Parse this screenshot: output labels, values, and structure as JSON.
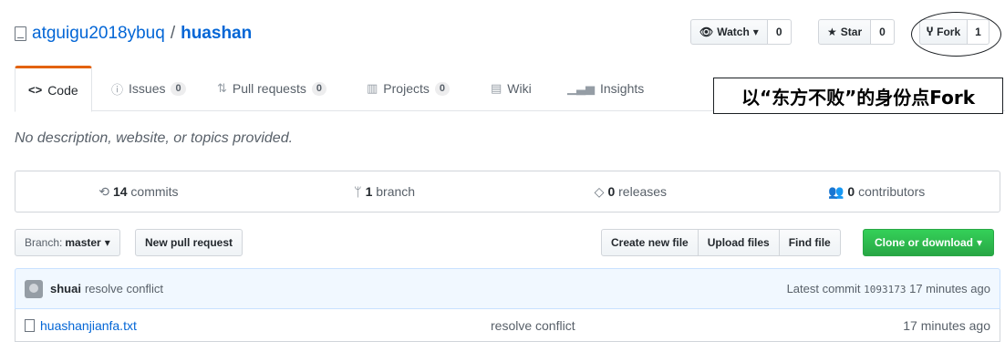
{
  "repo": {
    "owner": "atguigu2018ybuq",
    "separator": "/",
    "name": "huashan"
  },
  "social": {
    "watch": {
      "label": "Watch",
      "icon": "eye-icon",
      "caret": "▾",
      "count": "0"
    },
    "star": {
      "label": "Star",
      "icon": "star-icon",
      "count": "0"
    },
    "fork": {
      "label": "Fork",
      "icon": "fork-icon",
      "count": "1"
    }
  },
  "tabs": [
    {
      "label": "Code",
      "icon": "code-icon",
      "selected": true
    },
    {
      "label": "Issues",
      "icon": "issue-icon",
      "count": "0"
    },
    {
      "label": "Pull requests",
      "icon": "pull-request-icon",
      "count": "0"
    },
    {
      "label": "Projects",
      "icon": "project-icon",
      "count": "0"
    },
    {
      "label": "Wiki",
      "icon": "book-icon"
    },
    {
      "label": "Insights",
      "icon": "graph-icon"
    }
  ],
  "annotation": "以“东方不败”的身份点Fork",
  "description": "No description, website, or topics provided.",
  "summary": {
    "commits": {
      "num": "14",
      "label": "commits"
    },
    "branches": {
      "num": "1",
      "label": "branch"
    },
    "releases": {
      "num": "0",
      "label": "releases"
    },
    "contributors": {
      "num": "0",
      "label": "contributors"
    }
  },
  "file_nav": {
    "branch_label": "Branch:",
    "branch_value": "master",
    "new_pr": "New pull request",
    "create_file": "Create new file",
    "upload_files": "Upload files",
    "find_file": "Find file",
    "clone": "Clone or download"
  },
  "latest_commit": {
    "author": "shuai",
    "message": "resolve conflict",
    "prefix": "Latest commit",
    "sha": "1093173",
    "age": "17 minutes ago"
  },
  "files": [
    {
      "name": "huashanjianfa.txt",
      "message": "resolve conflict",
      "age": "17 minutes ago"
    }
  ],
  "colors": {
    "accent": "#0366d6",
    "tab_active": "#e36209",
    "clone_green": "#28a745"
  }
}
